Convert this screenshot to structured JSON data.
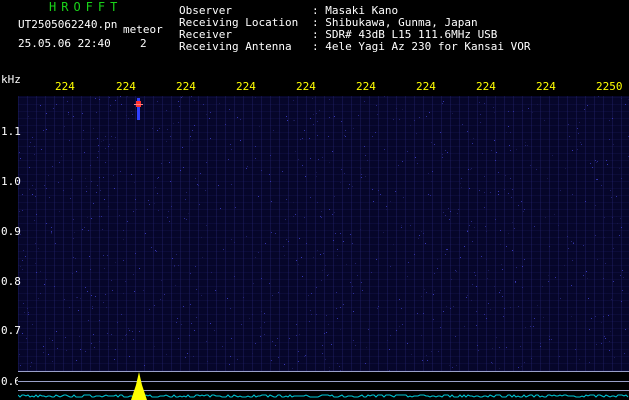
{
  "header": {
    "app_title": "HROFFT",
    "filename": "UT2505062240.pn",
    "suffix": "meteor",
    "datetime": "25.05.06 22:40",
    "count": "2",
    "info": [
      {
        "label": "Observer",
        "value": ": Masaki Kano"
      },
      {
        "label": "Receiving Location",
        "value": ": Shibukawa, Gunma, Japan"
      },
      {
        "label": "Receiver",
        "value": ": SDR# 43dB L15 111.6MHz USB"
      },
      {
        "label": "Receiving Antenna",
        "value": ": 4ele Yagi Az 230 for Kansai VOR"
      }
    ]
  },
  "axes": {
    "unit": "kHz",
    "x_ticks": [
      "224",
      "224",
      "224",
      "224",
      "224",
      "224",
      "224",
      "224",
      "224",
      "2250"
    ],
    "y_ticks": [
      "1.1",
      "1.0",
      "0.9",
      "0.8",
      "0.7",
      "0.6"
    ]
  },
  "colors": {
    "title": "#19d319",
    "tick_x": "#ffff00",
    "spectrum": "#00c8d8",
    "peak": "#ffff00",
    "detection": "#ff3030"
  }
}
